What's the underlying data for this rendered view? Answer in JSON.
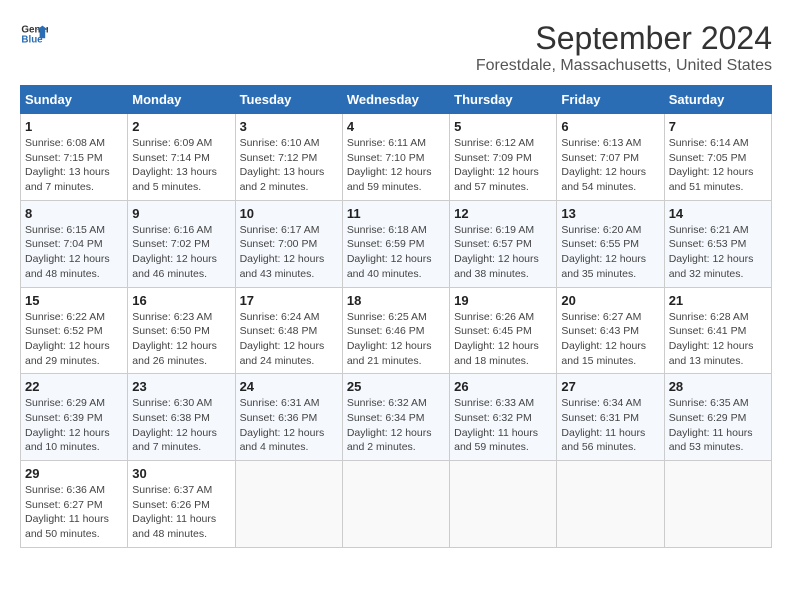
{
  "header": {
    "logo_line1": "General",
    "logo_line2": "Blue",
    "title": "September 2024",
    "subtitle": "Forestdale, Massachusetts, United States"
  },
  "weekdays": [
    "Sunday",
    "Monday",
    "Tuesday",
    "Wednesday",
    "Thursday",
    "Friday",
    "Saturday"
  ],
  "weeks": [
    [
      {
        "day": "1",
        "info": "Sunrise: 6:08 AM\nSunset: 7:15 PM\nDaylight: 13 hours and 7 minutes."
      },
      {
        "day": "2",
        "info": "Sunrise: 6:09 AM\nSunset: 7:14 PM\nDaylight: 13 hours and 5 minutes."
      },
      {
        "day": "3",
        "info": "Sunrise: 6:10 AM\nSunset: 7:12 PM\nDaylight: 13 hours and 2 minutes."
      },
      {
        "day": "4",
        "info": "Sunrise: 6:11 AM\nSunset: 7:10 PM\nDaylight: 12 hours and 59 minutes."
      },
      {
        "day": "5",
        "info": "Sunrise: 6:12 AM\nSunset: 7:09 PM\nDaylight: 12 hours and 57 minutes."
      },
      {
        "day": "6",
        "info": "Sunrise: 6:13 AM\nSunset: 7:07 PM\nDaylight: 12 hours and 54 minutes."
      },
      {
        "day": "7",
        "info": "Sunrise: 6:14 AM\nSunset: 7:05 PM\nDaylight: 12 hours and 51 minutes."
      }
    ],
    [
      {
        "day": "8",
        "info": "Sunrise: 6:15 AM\nSunset: 7:04 PM\nDaylight: 12 hours and 48 minutes."
      },
      {
        "day": "9",
        "info": "Sunrise: 6:16 AM\nSunset: 7:02 PM\nDaylight: 12 hours and 46 minutes."
      },
      {
        "day": "10",
        "info": "Sunrise: 6:17 AM\nSunset: 7:00 PM\nDaylight: 12 hours and 43 minutes."
      },
      {
        "day": "11",
        "info": "Sunrise: 6:18 AM\nSunset: 6:59 PM\nDaylight: 12 hours and 40 minutes."
      },
      {
        "day": "12",
        "info": "Sunrise: 6:19 AM\nSunset: 6:57 PM\nDaylight: 12 hours and 38 minutes."
      },
      {
        "day": "13",
        "info": "Sunrise: 6:20 AM\nSunset: 6:55 PM\nDaylight: 12 hours and 35 minutes."
      },
      {
        "day": "14",
        "info": "Sunrise: 6:21 AM\nSunset: 6:53 PM\nDaylight: 12 hours and 32 minutes."
      }
    ],
    [
      {
        "day": "15",
        "info": "Sunrise: 6:22 AM\nSunset: 6:52 PM\nDaylight: 12 hours and 29 minutes."
      },
      {
        "day": "16",
        "info": "Sunrise: 6:23 AM\nSunset: 6:50 PM\nDaylight: 12 hours and 26 minutes."
      },
      {
        "day": "17",
        "info": "Sunrise: 6:24 AM\nSunset: 6:48 PM\nDaylight: 12 hours and 24 minutes."
      },
      {
        "day": "18",
        "info": "Sunrise: 6:25 AM\nSunset: 6:46 PM\nDaylight: 12 hours and 21 minutes."
      },
      {
        "day": "19",
        "info": "Sunrise: 6:26 AM\nSunset: 6:45 PM\nDaylight: 12 hours and 18 minutes."
      },
      {
        "day": "20",
        "info": "Sunrise: 6:27 AM\nSunset: 6:43 PM\nDaylight: 12 hours and 15 minutes."
      },
      {
        "day": "21",
        "info": "Sunrise: 6:28 AM\nSunset: 6:41 PM\nDaylight: 12 hours and 13 minutes."
      }
    ],
    [
      {
        "day": "22",
        "info": "Sunrise: 6:29 AM\nSunset: 6:39 PM\nDaylight: 12 hours and 10 minutes."
      },
      {
        "day": "23",
        "info": "Sunrise: 6:30 AM\nSunset: 6:38 PM\nDaylight: 12 hours and 7 minutes."
      },
      {
        "day": "24",
        "info": "Sunrise: 6:31 AM\nSunset: 6:36 PM\nDaylight: 12 hours and 4 minutes."
      },
      {
        "day": "25",
        "info": "Sunrise: 6:32 AM\nSunset: 6:34 PM\nDaylight: 12 hours and 2 minutes."
      },
      {
        "day": "26",
        "info": "Sunrise: 6:33 AM\nSunset: 6:32 PM\nDaylight: 11 hours and 59 minutes."
      },
      {
        "day": "27",
        "info": "Sunrise: 6:34 AM\nSunset: 6:31 PM\nDaylight: 11 hours and 56 minutes."
      },
      {
        "day": "28",
        "info": "Sunrise: 6:35 AM\nSunset: 6:29 PM\nDaylight: 11 hours and 53 minutes."
      }
    ],
    [
      {
        "day": "29",
        "info": "Sunrise: 6:36 AM\nSunset: 6:27 PM\nDaylight: 11 hours and 50 minutes."
      },
      {
        "day": "30",
        "info": "Sunrise: 6:37 AM\nSunset: 6:26 PM\nDaylight: 11 hours and 48 minutes."
      },
      {
        "day": "",
        "info": ""
      },
      {
        "day": "",
        "info": ""
      },
      {
        "day": "",
        "info": ""
      },
      {
        "day": "",
        "info": ""
      },
      {
        "day": "",
        "info": ""
      }
    ]
  ]
}
